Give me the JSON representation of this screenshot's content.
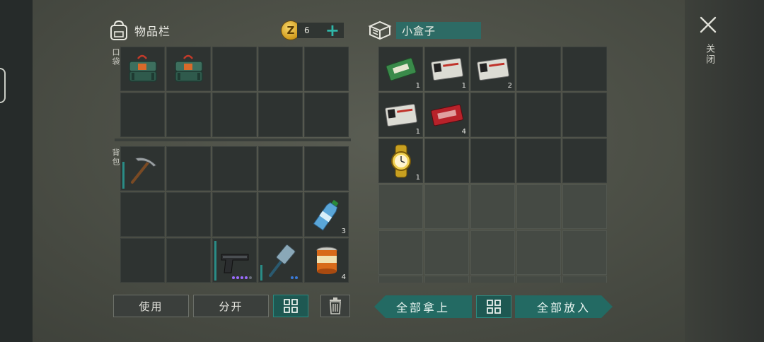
{
  "inventory": {
    "title": "物品栏",
    "coin_symbol": "Z",
    "coin_count": "6",
    "add_symbol": "+",
    "pocket_label": "口袋",
    "backpack_label": "背包",
    "pocket_items": [
      {
        "name": "military-crate",
        "count": ""
      },
      {
        "name": "military-crate",
        "count": ""
      }
    ],
    "backpack_items": [
      {
        "name": "pickaxe",
        "count": ""
      },
      {
        "name": "water-bottle",
        "count": "3"
      },
      {
        "name": "pistol",
        "count": ""
      },
      {
        "name": "sledgehammer",
        "count": ""
      },
      {
        "name": "canned-food",
        "count": "4"
      }
    ]
  },
  "container": {
    "title": "小盒子",
    "items": [
      {
        "name": "ration-coupon",
        "count": "1"
      },
      {
        "name": "r-army-coupon",
        "count": "1"
      },
      {
        "name": "a-army-coupon",
        "count": "2"
      },
      {
        "name": "c-army-coupon",
        "count": "1"
      },
      {
        "name": "combat-gear-coupon",
        "count": "4"
      },
      {
        "name": "gold-watch",
        "count": "1"
      }
    ]
  },
  "buttons": {
    "use": "使用",
    "split": "分开",
    "take_all": "全部拿上",
    "put_all": "全部放入"
  },
  "close_label": "关闭",
  "colors": {
    "accent": "#236a63",
    "accent_light": "#2fb6a8",
    "coin": "#d19b1c"
  },
  "icons": [
    "backpack-icon",
    "coin-icon",
    "box-icon",
    "sort-icon",
    "trash-icon",
    "close-icon"
  ]
}
